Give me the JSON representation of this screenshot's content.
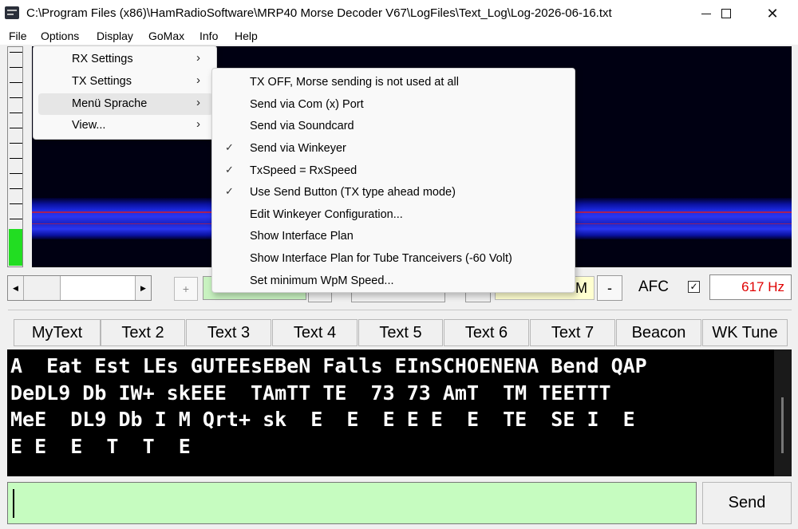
{
  "window": {
    "title": "C:\\Program Files (x86)\\HamRadioSoftware\\MRP40 Morse Decoder V67\\LogFiles\\Text_Log\\Log-2026-06-16.txt",
    "minimize_icon": "minimize-icon",
    "maximize_icon": "maximize-icon",
    "close_icon": "close-icon",
    "close_glyph": "✕"
  },
  "menubar": [
    "File",
    "Options",
    "Display",
    "GoMax",
    "Info",
    "Help"
  ],
  "options_menu": [
    {
      "label": "RX Settings",
      "arrow": "›"
    },
    {
      "label": "TX Settings",
      "arrow": "›"
    },
    {
      "label": "Menü Sprache",
      "arrow": "›"
    },
    {
      "label": "View...",
      "arrow": "›"
    }
  ],
  "tx_settings_menu": [
    {
      "label": "TX OFF, Morse sending is not used at all",
      "check": ""
    },
    {
      "label": "Send via Com (x) Port",
      "check": ""
    },
    {
      "label": "Send via Soundcard",
      "check": ""
    },
    {
      "label": "Send via Winkeyer",
      "check": "✓"
    },
    {
      "label": "TxSpeed = RxSpeed",
      "check": "✓"
    },
    {
      "label": "Use Send Button (TX type ahead  mode)",
      "check": "✓"
    },
    {
      "label": "Edit Winkeyer Configuration...",
      "check": ""
    },
    {
      "label": "Show Interface Plan",
      "check": ""
    },
    {
      "label": "Show Interface Plan for Tube Tranceivers (-60 Volt)",
      "check": ""
    },
    {
      "label": "Set minimum WpM Speed...",
      "check": ""
    }
  ],
  "controls": {
    "scroll_left": "◀",
    "scroll_right": "▶",
    "plus": "+",
    "minus": "-",
    "wpm_visible": "M",
    "afc_label": "AFC",
    "afc_checked": "✓",
    "frequency": "617 Hz"
  },
  "level_meter": {
    "level": 0.17,
    "color": "#22dd22"
  },
  "macro_buttons": [
    "MyText",
    "Text 2",
    "Text 3",
    "Text 4",
    "Text 5",
    "Text 6",
    "Text 7",
    "Beacon",
    "WK Tune"
  ],
  "decoded_text": [
    "A  Eat Est LEs GUTEEsEBeN Falls EInSCHOENENA Bend QAP",
    "DeDL9 Db IW+ skEEE  TAmTT TE  73 73 AmT  TM TEETTT",
    "MeE  DL9 Db I M Qrt+ sk  E  E  E E E  E  TE  SE I  E",
    "E E  E  T  T  E"
  ],
  "send_button": "Send",
  "colors": {
    "input_bg": "#c6fcc0",
    "frequency_text": "#e00000",
    "waterfall_signal": "#2a36f0"
  }
}
